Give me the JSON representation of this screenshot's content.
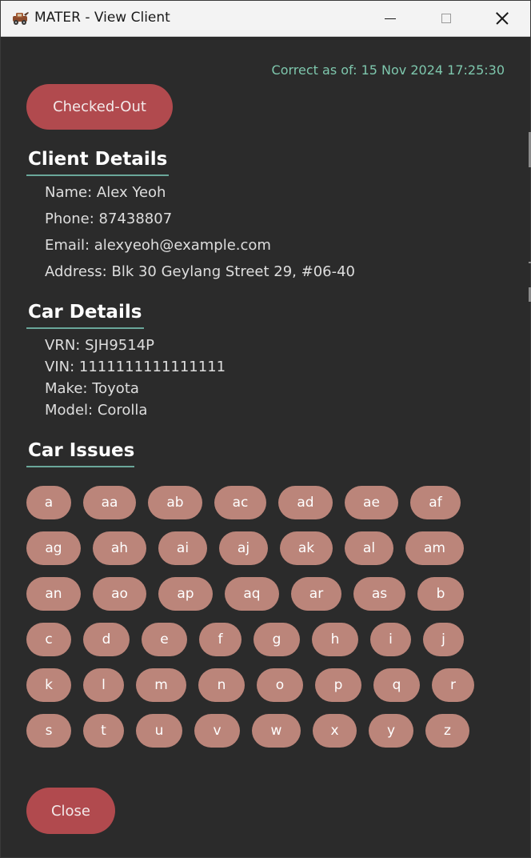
{
  "window": {
    "title": "MATER - View Client",
    "app_icon": "car-tow-icon",
    "controls": [
      "minimize-icon",
      "maximize-icon",
      "close-icon"
    ]
  },
  "timestamp": "Correct as of: 15 Nov 2024 17:25:30",
  "status_button": "Checked-Out",
  "client_details": {
    "heading": "Client Details",
    "name": "Name: Alex Yeoh",
    "phone": "Phone: 87438807",
    "email": "Email: alexyeoh@example.com",
    "address": "Address: Blk 30 Geylang Street 29, #06-40"
  },
  "car_details": {
    "heading": "Car Details",
    "vrn": "VRN: SJH9514P",
    "vin": "VIN: 1111111111111111",
    "make": "Make: Toyota",
    "model": "Model: Corolla"
  },
  "car_issues": {
    "heading": "Car Issues",
    "tags": [
      "a",
      "aa",
      "ab",
      "ac",
      "ad",
      "ae",
      "af",
      "ag",
      "ah",
      "ai",
      "aj",
      "ak",
      "al",
      "am",
      "an",
      "ao",
      "ap",
      "aq",
      "ar",
      "as",
      "b",
      "c",
      "d",
      "e",
      "f",
      "g",
      "h",
      "i",
      "j",
      "k",
      "l",
      "m",
      "n",
      "o",
      "p",
      "q",
      "r",
      "s",
      "t",
      "u",
      "v",
      "w",
      "x",
      "y",
      "z"
    ]
  },
  "close_button": "Close",
  "colors": {
    "accent_red": "#b14a4e",
    "tag_fill": "#bb857a",
    "timestamp_green": "#7ec7ad",
    "underline_teal": "#6aa79a",
    "background": "#2b2b2b"
  }
}
